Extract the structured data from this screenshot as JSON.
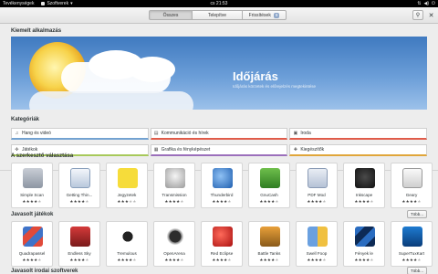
{
  "topbar": {
    "activities": "Tevékenységek",
    "app_menu": "Szoftverek",
    "clock": "cs 21:53",
    "sys_icons": [
      "network-icon",
      "volume-icon",
      "power-icon"
    ]
  },
  "header": {
    "tabs": [
      {
        "label": "Összes",
        "active": true
      },
      {
        "label": "Telepítve",
        "active": false
      },
      {
        "label": "Frissítések",
        "active": false,
        "badge": "9"
      }
    ]
  },
  "featured": {
    "heading": "Kiemelt alkalmazás",
    "title": "Időjárás",
    "subtitle": "Időjárás körzetek és előrejelzés megtekintése"
  },
  "categories": {
    "heading": "Kategóriák",
    "items": [
      {
        "label": "Hang és videó",
        "icon": "music-icon"
      },
      {
        "label": "Kommunikáció és hírek",
        "icon": "chat-icon"
      },
      {
        "label": "Iroda",
        "icon": "briefcase-icon"
      },
      {
        "label": "Játékok",
        "icon": "gamepad-icon"
      },
      {
        "label": "Grafika és fényképészet",
        "icon": "image-icon"
      },
      {
        "label": "Kiegészítők",
        "icon": "puzzle-icon"
      }
    ]
  },
  "editors_picks": {
    "heading": "A szerkesztő választása",
    "apps": [
      {
        "name": "Simple Scan",
        "rating": 4
      },
      {
        "name": "Getting Thin...",
        "rating": 4
      },
      {
        "name": "Jegyzetek",
        "rating": 3
      },
      {
        "name": "Transmission",
        "rating": 4
      },
      {
        "name": "Thunderbird",
        "rating": 4
      },
      {
        "name": "GnuCash",
        "rating": 4
      },
      {
        "name": "PDF Mod",
        "rating": 4
      },
      {
        "name": "Inkscape",
        "rating": 4
      },
      {
        "name": "Geary",
        "rating": 4
      }
    ]
  },
  "games": {
    "heading": "Javasolt játékok",
    "more_label": "Több...",
    "apps": [
      {
        "name": "Quadrapassel",
        "rating": 4
      },
      {
        "name": "Endless Sky",
        "rating": 4
      },
      {
        "name": "Tremulous",
        "rating": 4
      },
      {
        "name": "OpenArena",
        "rating": 4
      },
      {
        "name": "Red Eclipse",
        "rating": 4
      },
      {
        "name": "Battle Tanks",
        "rating": 4
      },
      {
        "name": "Swell Foop",
        "rating": 4
      },
      {
        "name": "Fények le",
        "rating": 4
      },
      {
        "name": "SuperTuxKart",
        "rating": 4
      }
    ]
  },
  "next_section": {
    "heading": "Javasolt irodai szoftverek",
    "more_label": "Több..."
  }
}
